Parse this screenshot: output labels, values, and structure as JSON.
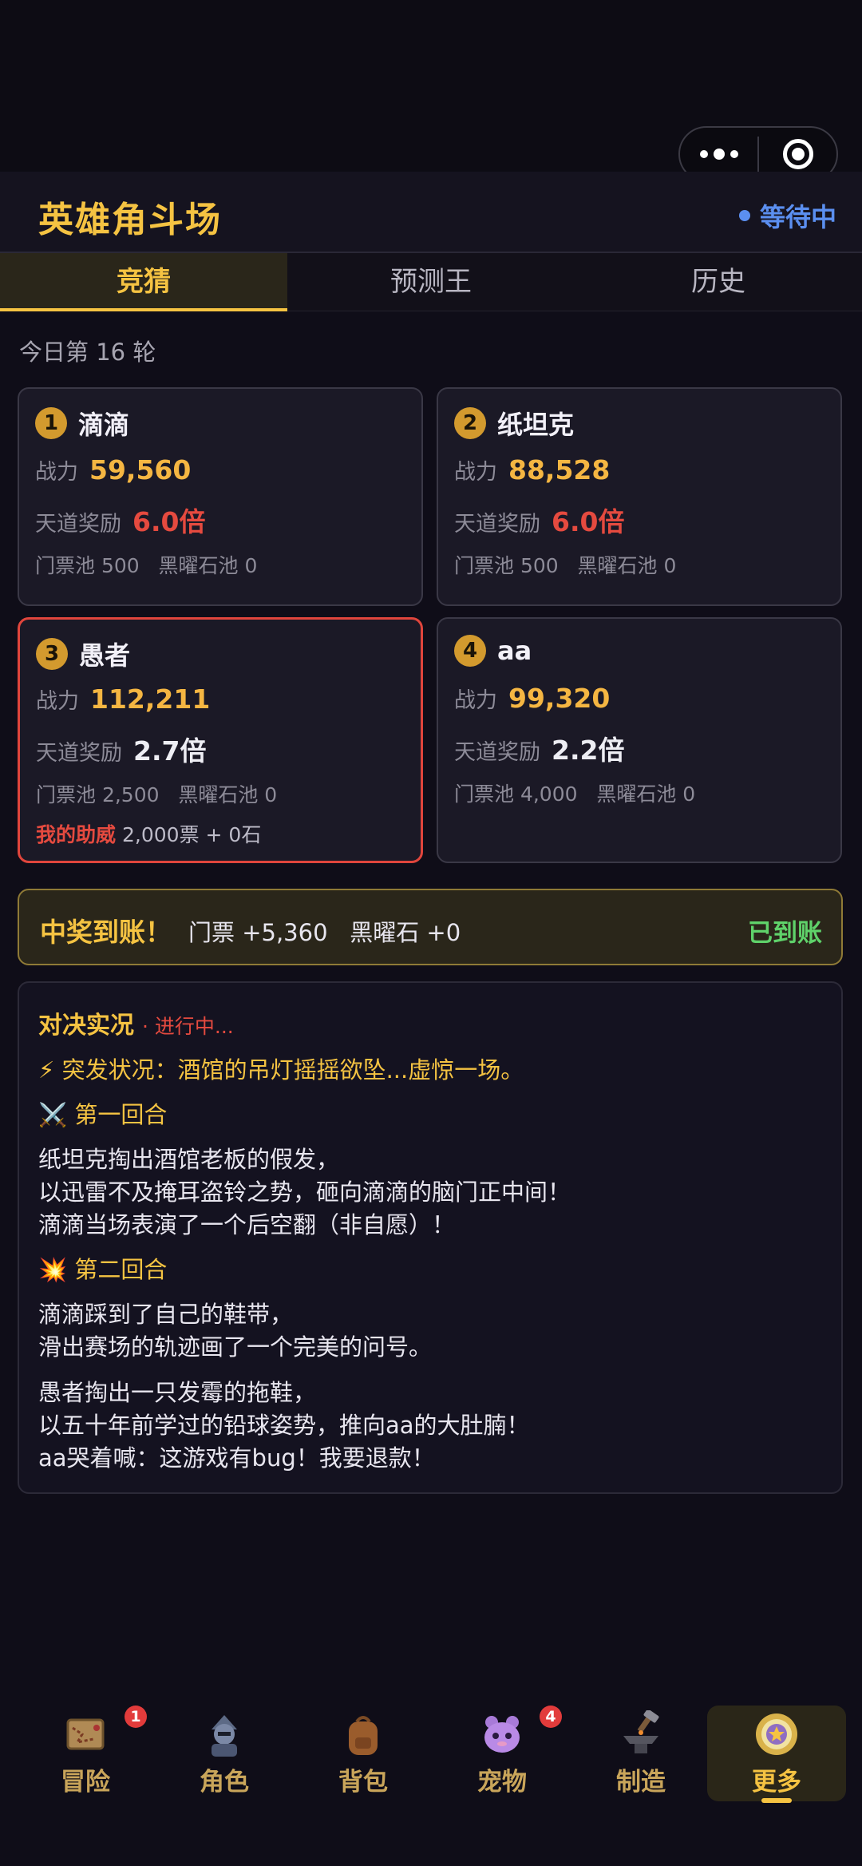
{
  "header": {
    "title": "英雄角斗场",
    "status": "等待中"
  },
  "tabs": [
    "竞猜",
    "预测王",
    "历史"
  ],
  "round_label": "今日第 16 轮",
  "labels": {
    "power": "战力",
    "reward": "天道奖励"
  },
  "fighters": [
    {
      "num": "1",
      "name": "滴滴",
      "power": "59,560",
      "multiplier": "6.0倍",
      "pool": "门票池 500   黑曜石池 0"
    },
    {
      "num": "2",
      "name": "纸坦克",
      "power": "88,528",
      "multiplier": "6.0倍",
      "pool": "门票池 500   黑曜石池 0"
    },
    {
      "num": "3",
      "name": "愚者",
      "power": "112,211",
      "multiplier": "2.7倍",
      "pool": "门票池 2,500   黑曜石池 0",
      "my_support_label": "我的助威",
      "my_support_value": "2,000票 + 0石"
    },
    {
      "num": "4",
      "name": "aa",
      "power": "99,320",
      "multiplier": "2.2倍",
      "pool": "门票池 4,000   黑曜石池 0"
    }
  ],
  "win_banner": {
    "title": "中奖到账！",
    "detail": "门票 +5,360   黑曜石 +0",
    "status": "已到账"
  },
  "battle": {
    "title": "对决实况",
    "state": "· 进行中...",
    "lines": [
      "⚡ 突发状况：酒馆的吊灯摇摇欲坠...虚惊一场。",
      "⚔️ 第一回合",
      "纸坦克掏出酒馆老板的假发，",
      "以迅雷不及掩耳盗铃之势，砸向滴滴的脑门正中间！",
      "滴滴当场表演了一个后空翻（非自愿）！",
      "💥 第二回合",
      "滴滴踩到了自己的鞋带，",
      "滑出赛场的轨迹画了一个完美的问号。",
      "愚者掏出一只发霉的拖鞋，",
      "以五十年前学过的铅球姿势，推向aa的大肚腩！",
      "aa哭着喊：这游戏有bug！我要退款！"
    ]
  },
  "nav": [
    {
      "label": "冒险",
      "badge": "1"
    },
    {
      "label": "角色"
    },
    {
      "label": "背包"
    },
    {
      "label": "宠物",
      "badge": "4"
    },
    {
      "label": "制造"
    },
    {
      "label": "更多"
    }
  ],
  "colors": {
    "accent": "#f5c342",
    "danger": "#e54a3f",
    "info": "#5b8ff0",
    "success": "#5fd26a",
    "background": "#0f0d18"
  }
}
